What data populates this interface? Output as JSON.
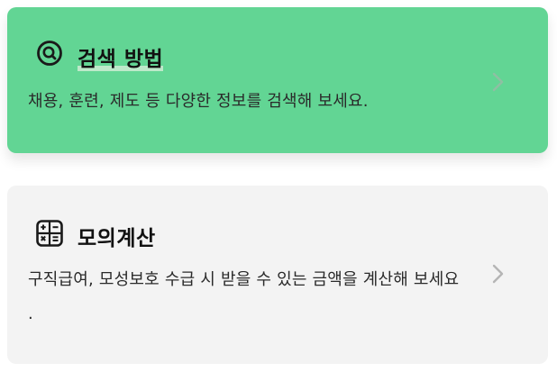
{
  "cards": [
    {
      "title": "검색 방법",
      "description": "채용, 훈련, 제도 등 다양한 정보를 검색해 보세요.",
      "icon": "search-icon",
      "background": "#62d594"
    },
    {
      "title": "모의계산",
      "description_line1": "구직급여, 모성보호 수급 시 받을 수 있는 금액을 계산해 보세요",
      "description_line2": ".",
      "icon": "calculator-icon",
      "background": "#f3f3f3"
    }
  ]
}
